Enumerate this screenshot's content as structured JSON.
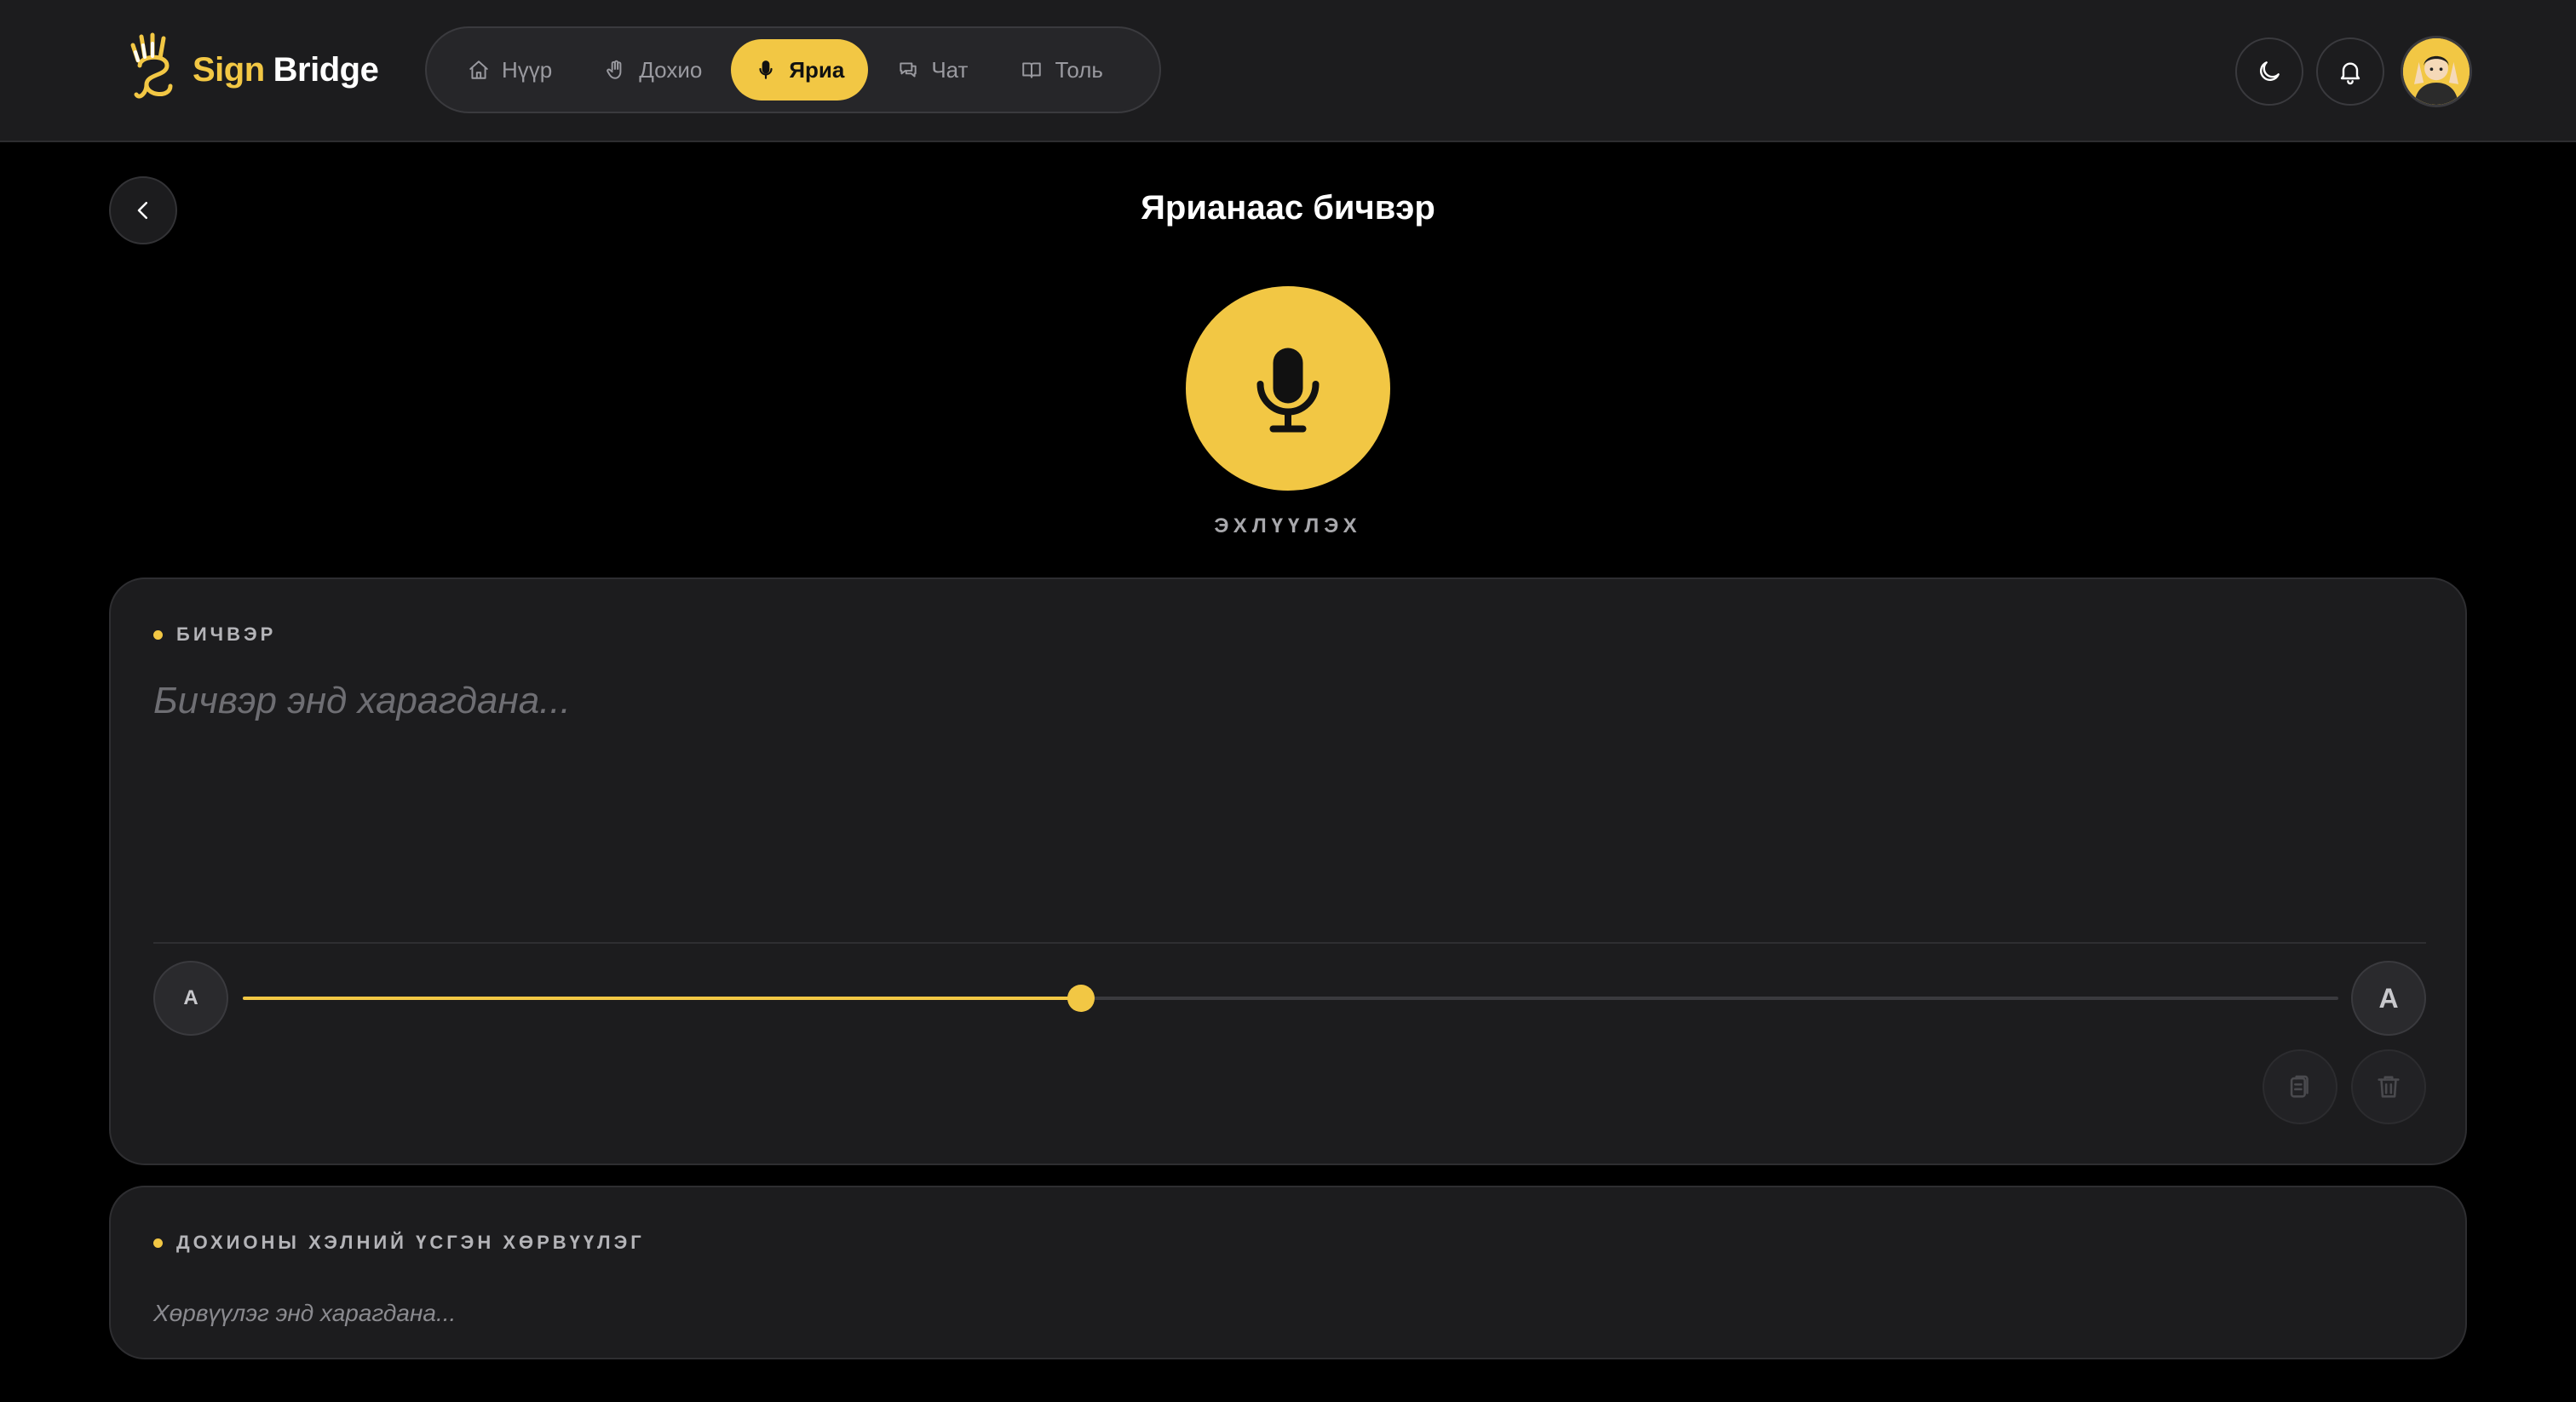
{
  "app": {
    "brand_part1": "Sign",
    "brand_part2": "Bridge"
  },
  "nav": {
    "items": [
      {
        "label": "Нүүр",
        "icon": "home-icon"
      },
      {
        "label": "Дохио",
        "icon": "hand-icon"
      },
      {
        "label": "Яриа",
        "icon": "microphone-icon",
        "active": true
      },
      {
        "label": "Чат",
        "icon": "chat-icon"
      },
      {
        "label": "Толь",
        "icon": "book-icon"
      }
    ]
  },
  "header_actions": {
    "theme_icon": "moon-icon",
    "notifications_icon": "bell-icon",
    "avatar_icon": "user-avatar"
  },
  "page": {
    "title": "Ярианаас бичвэр",
    "record_label": "ЭХЛҮҮЛЭХ"
  },
  "transcript": {
    "heading": "БИЧВЭР",
    "placeholder": "Бичвэр энд харагдана...",
    "font_small_label": "A",
    "font_large_label": "A",
    "font_size_level": 0.4
  },
  "translation": {
    "heading": "ДОХИОНЫ ХЭЛНИЙ ҮСГЭН ХӨРВҮҮЛЭГ",
    "placeholder": "Хөрвүүлэг энд харагдана..."
  },
  "colors": {
    "accent": "#f2c744",
    "background": "#000000",
    "surface": "#1c1c1e"
  }
}
